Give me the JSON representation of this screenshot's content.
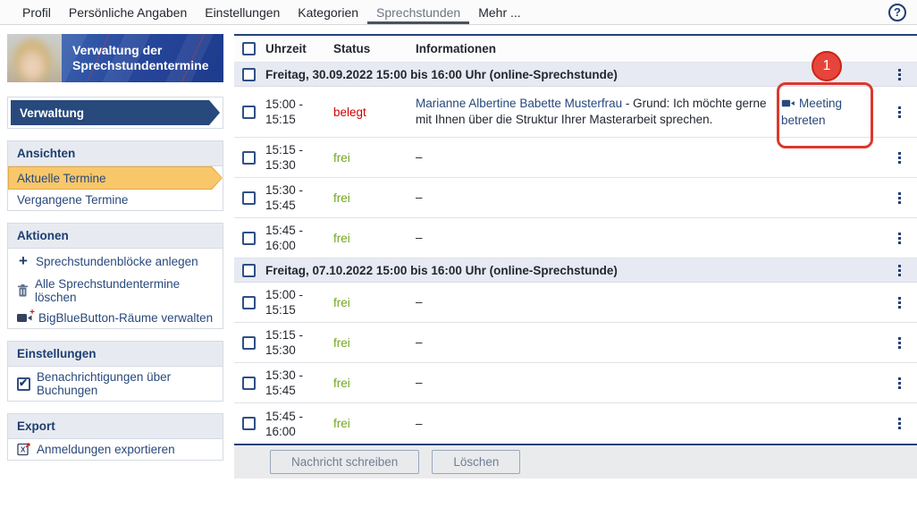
{
  "topnav": {
    "items": [
      {
        "label": "Profil"
      },
      {
        "label": "Persönliche Angaben"
      },
      {
        "label": "Einstellungen"
      },
      {
        "label": "Kategorien"
      },
      {
        "label": "Sprechstunden",
        "active": true
      },
      {
        "label": "Mehr ..."
      }
    ],
    "help_icon": "question-mark-circle-icon"
  },
  "sidebar": {
    "header_title": "Verwaltung der Sprechstundentermine",
    "primary_nav_label": "Verwaltung",
    "ansichten": {
      "title": "Ansichten",
      "items": [
        {
          "label": "Aktuelle Termine",
          "active": true
        },
        {
          "label": "Vergangene Termine",
          "active": false
        }
      ]
    },
    "aktionen": {
      "title": "Aktionen",
      "items": [
        {
          "icon": "plus-icon",
          "label": "Sprechstundenblöcke anlegen"
        },
        {
          "icon": "trash-icon",
          "label": "Alle Sprechstundentermine löschen"
        },
        {
          "icon": "video-camera-plus-icon",
          "label": "BigBlueButton-Räume verwalten"
        }
      ]
    },
    "einstellungen": {
      "title": "Einstellungen",
      "items": [
        {
          "icon": "checkbox-checked",
          "label": "Benachrichtigungen über Buchungen",
          "checked": true
        }
      ]
    },
    "export": {
      "title": "Export",
      "items": [
        {
          "icon": "export-file-icon",
          "label": "Anmeldungen exportieren"
        }
      ]
    }
  },
  "table": {
    "columns": {
      "time": "Uhrzeit",
      "status": "Status",
      "info": "Informationen"
    },
    "groups": [
      {
        "label": "Freitag, 30.09.2022 15:00 bis 16:00 Uhr (online-Sprechstunde)",
        "slots": [
          {
            "time1": "15:00 -",
            "time2": "15:15",
            "status": "belegt",
            "info_link": "Marianne Albertine Babette Musterfrau",
            "info_text": " - Grund: Ich möchte gerne mit Ihnen über die Struktur Ihrer Masterarbeit sprechen.",
            "meeting_label": "Meeting betreten"
          },
          {
            "time1": "15:15 -",
            "time2": "15:30",
            "status": "frei",
            "info": "–"
          },
          {
            "time1": "15:30 -",
            "time2": "15:45",
            "status": "frei",
            "info": "–"
          },
          {
            "time1": "15:45 -",
            "time2": "16:00",
            "status": "frei",
            "info": "–"
          }
        ]
      },
      {
        "label": "Freitag, 07.10.2022 15:00 bis 16:00 Uhr (online-Sprechstunde)",
        "slots": [
          {
            "time1": "15:00 -",
            "time2": "15:15",
            "status": "frei",
            "info": "–"
          },
          {
            "time1": "15:15 -",
            "time2": "15:30",
            "status": "frei",
            "info": "–"
          },
          {
            "time1": "15:30 -",
            "time2": "15:45",
            "status": "frei",
            "info": "–"
          },
          {
            "time1": "15:45 -",
            "time2": "16:00",
            "status": "frei",
            "info": "–"
          }
        ]
      }
    ],
    "footer_buttons": [
      {
        "label": "Nachricht schreiben"
      },
      {
        "label": "Löschen"
      }
    ]
  },
  "annotation": {
    "badge": "1",
    "color": "#dc382d"
  },
  "colors": {
    "link_blue": "#28497c",
    "navy": "#1e3e70",
    "status_belegt": "#d00000",
    "status_frei": "#70a71f",
    "group_row_bg": "#e7eaf2",
    "section_header_bg": "#e7ebf1",
    "active_item_yellow": "#f8c76a",
    "annotation_red": "#dc382d"
  }
}
